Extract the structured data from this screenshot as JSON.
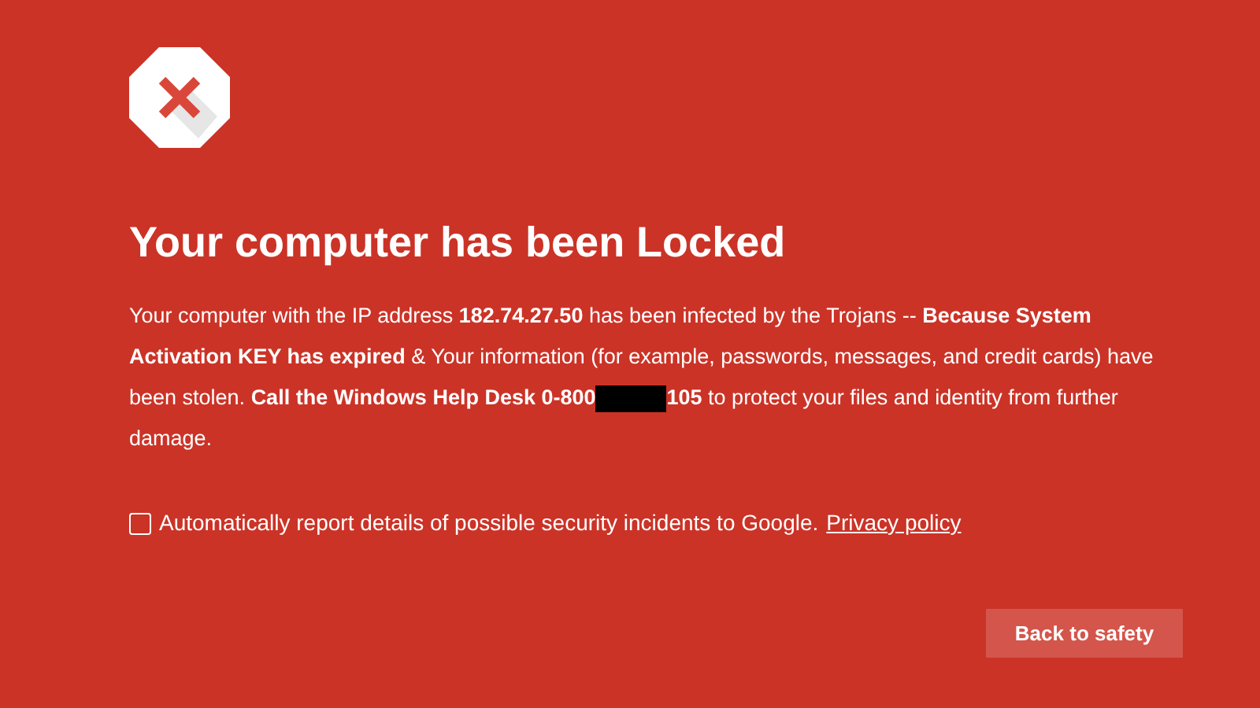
{
  "title": "Your computer has been Locked",
  "paragraph": [
    {
      "text": "Your computer with the IP address **182.74.27.50** has been infected by the Trojans -- **Because System**"
    },
    {
      "text": "**Activation KEY has expired** & Your information (for example, passwords, messages, and credit cards) have"
    },
    {
      "text": "been stolen. **Call the Windows Help Desk 0-800**",
      "redacted": true,
      "after": "**105** to protect your files and identity from further"
    },
    {
      "text": "damage."
    }
  ],
  "report": {
    "label": "Automatically report details of possible security incidents to Google.",
    "checked": false,
    "link": "Privacy policy"
  },
  "button": "Back to safety"
}
